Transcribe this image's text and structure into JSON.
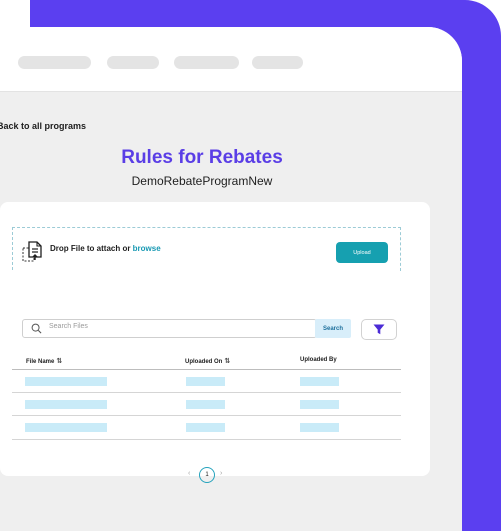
{
  "nav": {
    "back_label": "Back to all programs"
  },
  "page": {
    "title": "Rules for Rebates",
    "subtitle": "DemoRebateProgramNew"
  },
  "upload": {
    "drop_text": "Drop File to attach or ",
    "browse_text": "browse",
    "button_label": "Upload"
  },
  "search": {
    "placeholder": "Search Files",
    "button_label": "Search"
  },
  "table": {
    "columns": [
      "File Name",
      "Uploaded On",
      "Uploaded By"
    ]
  },
  "pagination": {
    "current_page": "1",
    "prev_icon": "chevron-left",
    "next_icon": "chevron-right"
  },
  "icons": {
    "file": "file-upload-icon",
    "search": "search-icon",
    "filter": "filter-icon",
    "sort": "sort-icon"
  },
  "colors": {
    "frame": "#5b3ff0",
    "title": "#5a3ee6",
    "accent": "#16a0b0",
    "skeleton": "#c9ebf8"
  }
}
